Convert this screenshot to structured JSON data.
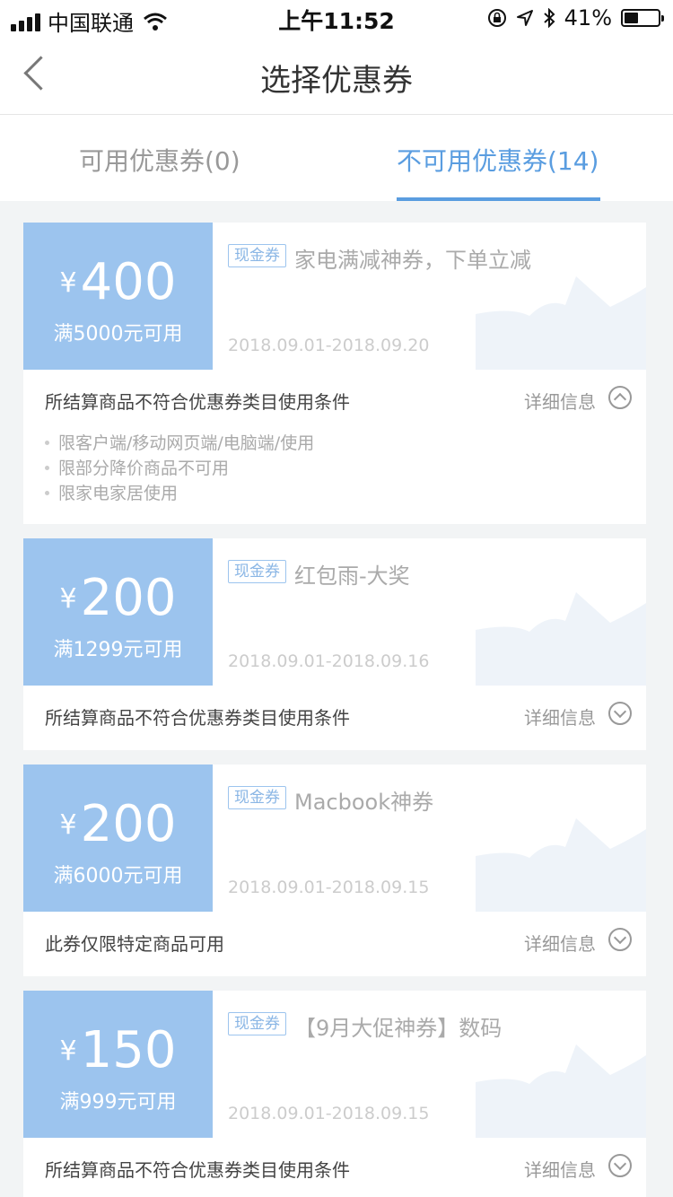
{
  "status_bar": {
    "carrier": "中国联通",
    "time": "上午11:52",
    "battery_pct": "41%",
    "battery_level": 0.41
  },
  "nav": {
    "title": "选择优惠券",
    "back_icon": "chevron-left-icon"
  },
  "tabs": [
    {
      "label": "可用优惠券(0)",
      "active": false
    },
    {
      "label": "不可用优惠券(14)",
      "active": true
    }
  ],
  "colors": {
    "accent": "#5a9de0",
    "coupon_bg": "#9cc4ee",
    "page_bg": "#f2f4f5"
  },
  "coupons": [
    {
      "currency": "¥",
      "amount": "400",
      "condition": "满5000元可用",
      "tag": "现金券",
      "name": "家电满减神券，下单立减",
      "date": "2018.09.01-2018.09.20",
      "reason": "所结算商品不符合优惠券类目使用条件",
      "detail_label": "详细信息",
      "expanded": true,
      "rules": [
        "限客户端/移动网页端/电脑端/使用",
        "限部分降价商品不可用",
        "限家电家居使用"
      ]
    },
    {
      "currency": "¥",
      "amount": "200",
      "condition": "满1299元可用",
      "tag": "现金券",
      "name": "红包雨-大奖",
      "date": "2018.09.01-2018.09.16",
      "reason": "所结算商品不符合优惠券类目使用条件",
      "detail_label": "详细信息",
      "expanded": false
    },
    {
      "currency": "¥",
      "amount": "200",
      "condition": "满6000元可用",
      "tag": "现金券",
      "name": "Macbook神券",
      "date": "2018.09.01-2018.09.15",
      "reason": "此券仅限特定商品可用",
      "detail_label": "详细信息",
      "expanded": false
    },
    {
      "currency": "¥",
      "amount": "150",
      "condition": "满999元可用",
      "tag": "现金券",
      "name": "【9月大促神券】数码",
      "date": "2018.09.01-2018.09.15",
      "reason": "所结算商品不符合优惠券类目使用条件",
      "detail_label": "详细信息",
      "expanded": false
    }
  ]
}
